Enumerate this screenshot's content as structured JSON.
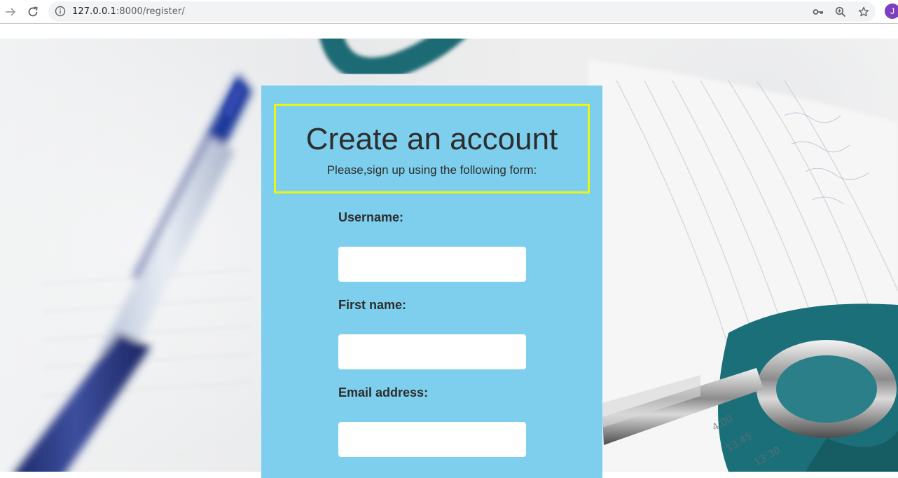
{
  "browser": {
    "url_host": "127.0.0.1",
    "url_rest": ":8000/register/",
    "profile_initial": "J"
  },
  "form": {
    "title": "Create an account",
    "subtitle": "Please,sign up using the following form:",
    "fields": [
      {
        "label": "Username:",
        "value": ""
      },
      {
        "label": "First name:",
        "value": ""
      },
      {
        "label": "Email address:",
        "value": ""
      }
    ]
  },
  "colors": {
    "card_background": "#7ecfed",
    "title_border": "#e7f518",
    "avatar": "#7b3fbf"
  }
}
